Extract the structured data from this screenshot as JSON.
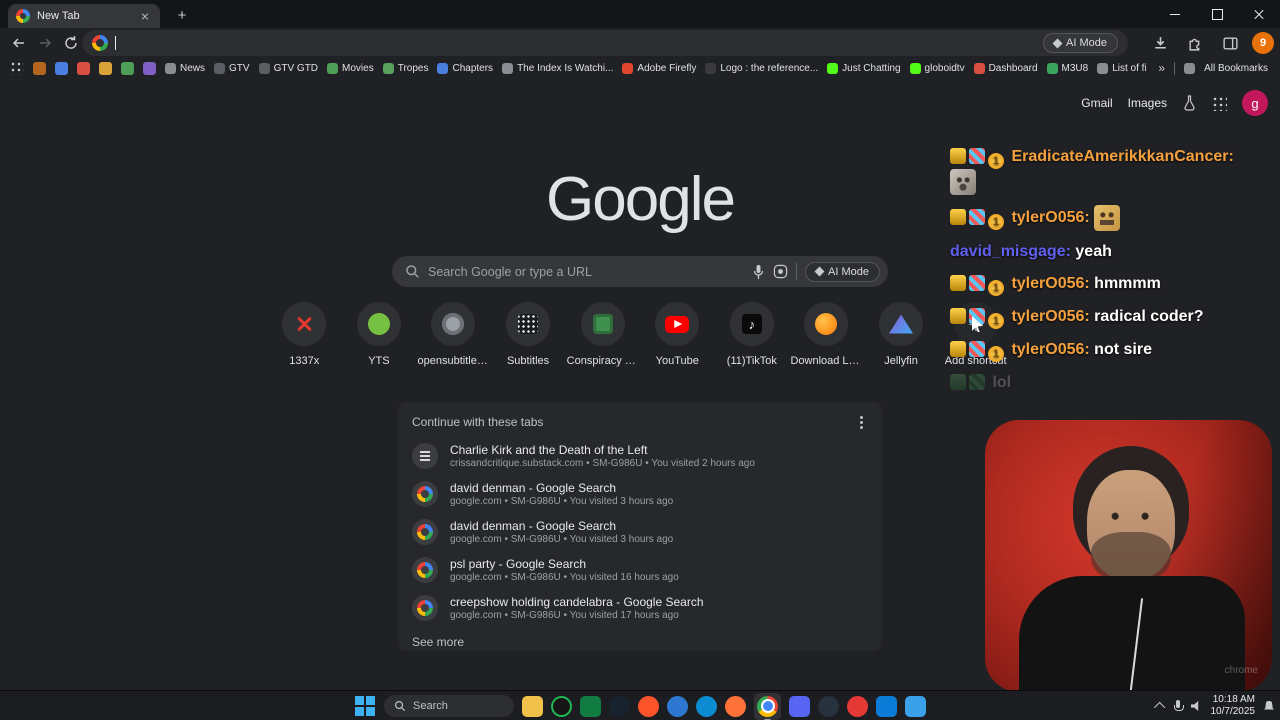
{
  "browser": {
    "tab_title": "New Tab",
    "omnibox_ai_label": "AI Mode",
    "profile_badge": "9"
  },
  "bookmarks_bar": {
    "favicons": [
      "#b5651d",
      "#4a7fe0",
      "#d94f43",
      "#d9a33a",
      "#4f9e57",
      "#7e5fc4"
    ],
    "items": [
      {
        "label": "News",
        "icon_color": "#8a8d91"
      },
      {
        "label": "GTV",
        "icon_color": "#5b5e63"
      },
      {
        "label": "GTV GTD",
        "icon_color": "#5b5e63"
      },
      {
        "label": "Movies",
        "icon_color": "#4f9e57"
      },
      {
        "label": "Tropes",
        "icon_color": "#58a05c"
      },
      {
        "label": "Chapters",
        "icon_color": "#4a7fe0"
      },
      {
        "label": "The Index Is Watchi...",
        "icon_color": "#8a8d91"
      },
      {
        "label": "Adobe Firefly",
        "icon_color": "#e0452e"
      },
      {
        "label": "Logo : the reference...",
        "icon_color": "#3a3b3e"
      },
      {
        "label": "Just Chatting",
        "icon_color": "#53fc18"
      },
      {
        "label": "globoidtv",
        "icon_color": "#53fc18"
      },
      {
        "label": "Dashboard",
        "icon_color": "#d94f43"
      },
      {
        "label": "M3U8",
        "icon_color": "#3ba55d"
      },
      {
        "label": "List of films featurin...",
        "icon_color": "#8a8d91"
      }
    ],
    "overflow_chevron": "»",
    "all_bookmarks_label": "All Bookmarks"
  },
  "page_header": {
    "gmail": "Gmail",
    "images": "Images",
    "avatar_letter": "g"
  },
  "newtab": {
    "logo": "Google",
    "search_placeholder": "Search Google or type a URL",
    "ai_mode_label": "AI Mode",
    "add_shortcut_label": "Add shortcut",
    "shortcuts": [
      {
        "label": "1337x"
      },
      {
        "label": "YTS"
      },
      {
        "label": "opensubtitles..."
      },
      {
        "label": "Subtitles"
      },
      {
        "label": "Conspiracy M..."
      },
      {
        "label": "YouTube"
      },
      {
        "label": "(11)TikTok"
      },
      {
        "label": "Download La..."
      },
      {
        "label": "Jellyfin"
      }
    ]
  },
  "continue_card": {
    "title": "Continue with these tabs",
    "see_more": "See more",
    "items": [
      {
        "title": "Charlie Kirk and the Death of the Left",
        "meta": "crissandcritique.substack.com • SM-G986U • You visited 2 hours ago"
      },
      {
        "title": "david denman - Google Search",
        "meta": "google.com • SM-G986U • You visited 3 hours ago"
      },
      {
        "title": "david denman - Google Search",
        "meta": "google.com • SM-G986U • You visited 3 hours ago"
      },
      {
        "title": "psl party - Google Search",
        "meta": "google.com • SM-G986U • You visited 16 hours ago"
      },
      {
        "title": "creepshow holding candelabra - Google Search",
        "meta": "google.com • SM-G986U • You visited 17 hours ago"
      }
    ]
  },
  "chat": {
    "coin_badge": "1",
    "messages": [
      {
        "name": "EradicateAmerikkkanCancer:",
        "text": "",
        "color": "#f5a13d"
      },
      {
        "name": "tylerO056:",
        "text": "",
        "color": "#f5a13d"
      },
      {
        "name": "david_misgage:",
        "text": "yeah",
        "color": "#6060f0"
      },
      {
        "name": "tylerO056:",
        "text": "hmmmm",
        "color": "#f5a13d"
      },
      {
        "name": "tylerO056:",
        "text": "radical coder?",
        "color": "#f5a13d"
      },
      {
        "name": "tylerO056:",
        "text": "not sire",
        "color": "#f5a13d"
      },
      {
        "name": "",
        "text": "lol",
        "color": "#57d26a"
      }
    ]
  },
  "webcam": {
    "watermark": "chrome"
  },
  "taskbar": {
    "search_placeholder": "Search",
    "time": "10:18 AM",
    "date": "10/7/2025",
    "icons": [
      {
        "name": "file-explorer",
        "color": "#f0c14b"
      },
      {
        "name": "spotify",
        "color": "#161616"
      },
      {
        "name": "excel",
        "color": "#107c41"
      },
      {
        "name": "4k-downloader",
        "color": "#18222e"
      },
      {
        "name": "brave",
        "color": "#fb542b"
      },
      {
        "name": "media-player",
        "color": "#2e77d0"
      },
      {
        "name": "edge",
        "color": "#0b8bd0"
      },
      {
        "name": "firefox",
        "color": "#ff7139"
      },
      {
        "name": "chrome",
        "color": "#4285f4"
      },
      {
        "name": "discord",
        "color": "#5865f2"
      },
      {
        "name": "steam",
        "color": "#28323f"
      },
      {
        "name": "youtube-music",
        "color": "#e53935"
      },
      {
        "name": "vscode",
        "color": "#0a7bd6"
      },
      {
        "name": "notepad",
        "color": "#3aa0e8"
      }
    ]
  }
}
